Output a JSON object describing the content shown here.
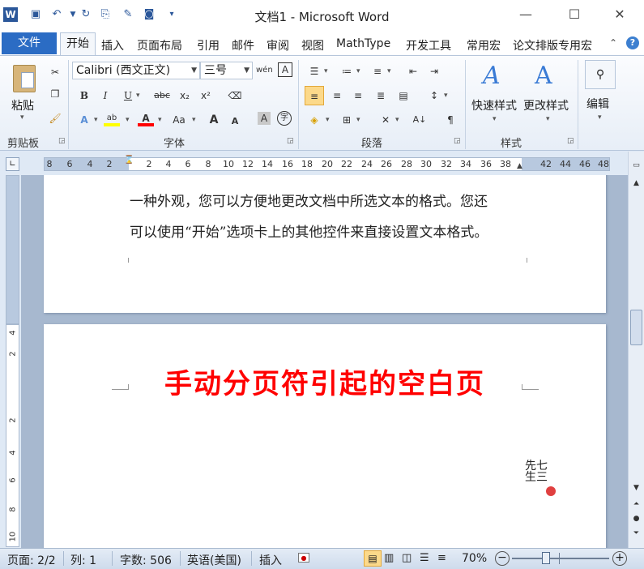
{
  "title": "文档1 - Microsoft Word",
  "window": {
    "minimize": "—",
    "maximize": "☐",
    "close": "✕"
  },
  "qat": {
    "app_icon": "W",
    "save": "💾",
    "undo": "↶",
    "redo": "↻",
    "customize": "▾"
  },
  "tabs": [
    "开始",
    "插入",
    "页面布局",
    "引用",
    "邮件",
    "审阅",
    "视图",
    "MathType",
    "开发工具",
    "常用宏",
    "论文排版专用宏"
  ],
  "file_tab": "文件",
  "ribbon": {
    "clipboard": {
      "paste": "粘贴",
      "label": "剪贴板"
    },
    "font": {
      "name": "Calibri (西文正文)",
      "size": "三号",
      "label": "字体",
      "bold": "B",
      "italic": "I",
      "underline": "U",
      "strike": "abc",
      "sub": "x₂",
      "sup": "x²",
      "grow": "A",
      "shrink": "A",
      "aa": "Aa",
      "wen": "wén",
      "char_border": "A"
    },
    "paragraph": {
      "label": "段落"
    },
    "styles": {
      "quick": "快速样式",
      "change": "更改样式",
      "label": "样式"
    },
    "editing": {
      "label": "编辑"
    }
  },
  "ruler_h_numbers": [
    "8",
    "6",
    "4",
    "2",
    "2",
    "4",
    "6",
    "8",
    "10",
    "12",
    "14",
    "16",
    "18",
    "20",
    "22",
    "24",
    "26",
    "28",
    "30",
    "32",
    "34",
    "36",
    "38",
    "42",
    "44",
    "46",
    "48"
  ],
  "ruler_v_numbers": [
    "4",
    "2",
    "2",
    "4",
    "6",
    "8",
    "10"
  ],
  "document": {
    "page1_line1": "一种外观，您可以方便地更改文档中所选文本的格式。您还",
    "page1_line2": "可以使用“开始”选项卡上的其他控件来直接设置文本格式。",
    "page2_heading": "手动分页符引起的空白页"
  },
  "status": {
    "page": "页面: 2/2",
    "col": "列: 1",
    "words": "字数: 506",
    "lang": "英语(美国)",
    "mode": "插入",
    "zoom": "70%",
    "zoom_out": "−",
    "zoom_in": "+"
  },
  "colors": {
    "accent": "#2b6cc4",
    "heading": "#ff0000"
  }
}
